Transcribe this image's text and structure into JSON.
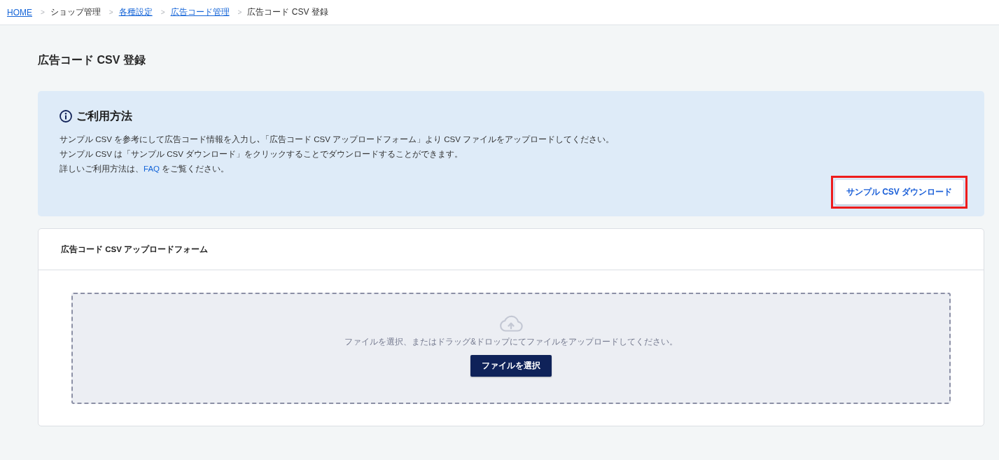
{
  "breadcrumb": [
    {
      "label": "HOME",
      "link": true
    },
    {
      "separator": ">",
      "label": "ショップ管理",
      "link": false
    },
    {
      "separator": ">",
      "label": "各種設定",
      "link": true
    },
    {
      "separator": ">",
      "label": "広告コード管理",
      "link": true
    },
    {
      "separator": ">",
      "label": "広告コード CSV 登録",
      "link": false
    }
  ],
  "page_title": "広告コード CSV 登録",
  "info_panel": {
    "heading": "ご利用方法",
    "lines": [
      {
        "text": "サンプル CSV を参考にして広告コード情報を入力し､「広告コード CSV アップロードフォーム」より CSV ファイルをアップロードしてください。"
      },
      {
        "text": "サンプル CSV は「サンプル CSV ダウンロード」をクリックすることでダウンロードすることができます。"
      },
      {
        "text": "詳しいご利用方法は、",
        "link": "FAQ",
        "text_after": " をご覧ください。"
      }
    ],
    "button": {
      "label": "サンプル CSV ダウンロード",
      "highlighted": true
    }
  },
  "upload_form": {
    "title": "広告コード CSV アップロードフォーム",
    "dropzone": {
      "hint": "ファイルを選択、またはドラッグ&ドロップにてファイルをアップロードしてください。",
      "button": "ファイルを選択"
    }
  }
}
